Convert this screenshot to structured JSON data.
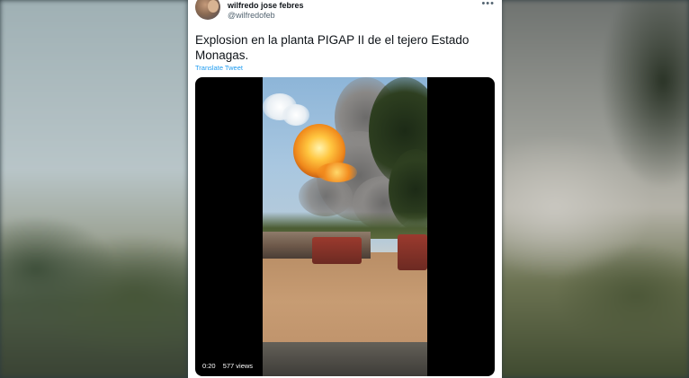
{
  "tweet": {
    "display_name": "wilfredo jose febres",
    "handle": "@wilfredofeb",
    "more_icon": "more-horizontal-icon",
    "text": "Explosion en la planta PIGAP II de el tejero Estado Monagas.",
    "translate_label": "Translate Tweet"
  },
  "video": {
    "duration": "0:20",
    "views": "577 views"
  },
  "colors": {
    "link": "#1d9bf0",
    "text": "#0f1419",
    "secondary": "#536471"
  }
}
